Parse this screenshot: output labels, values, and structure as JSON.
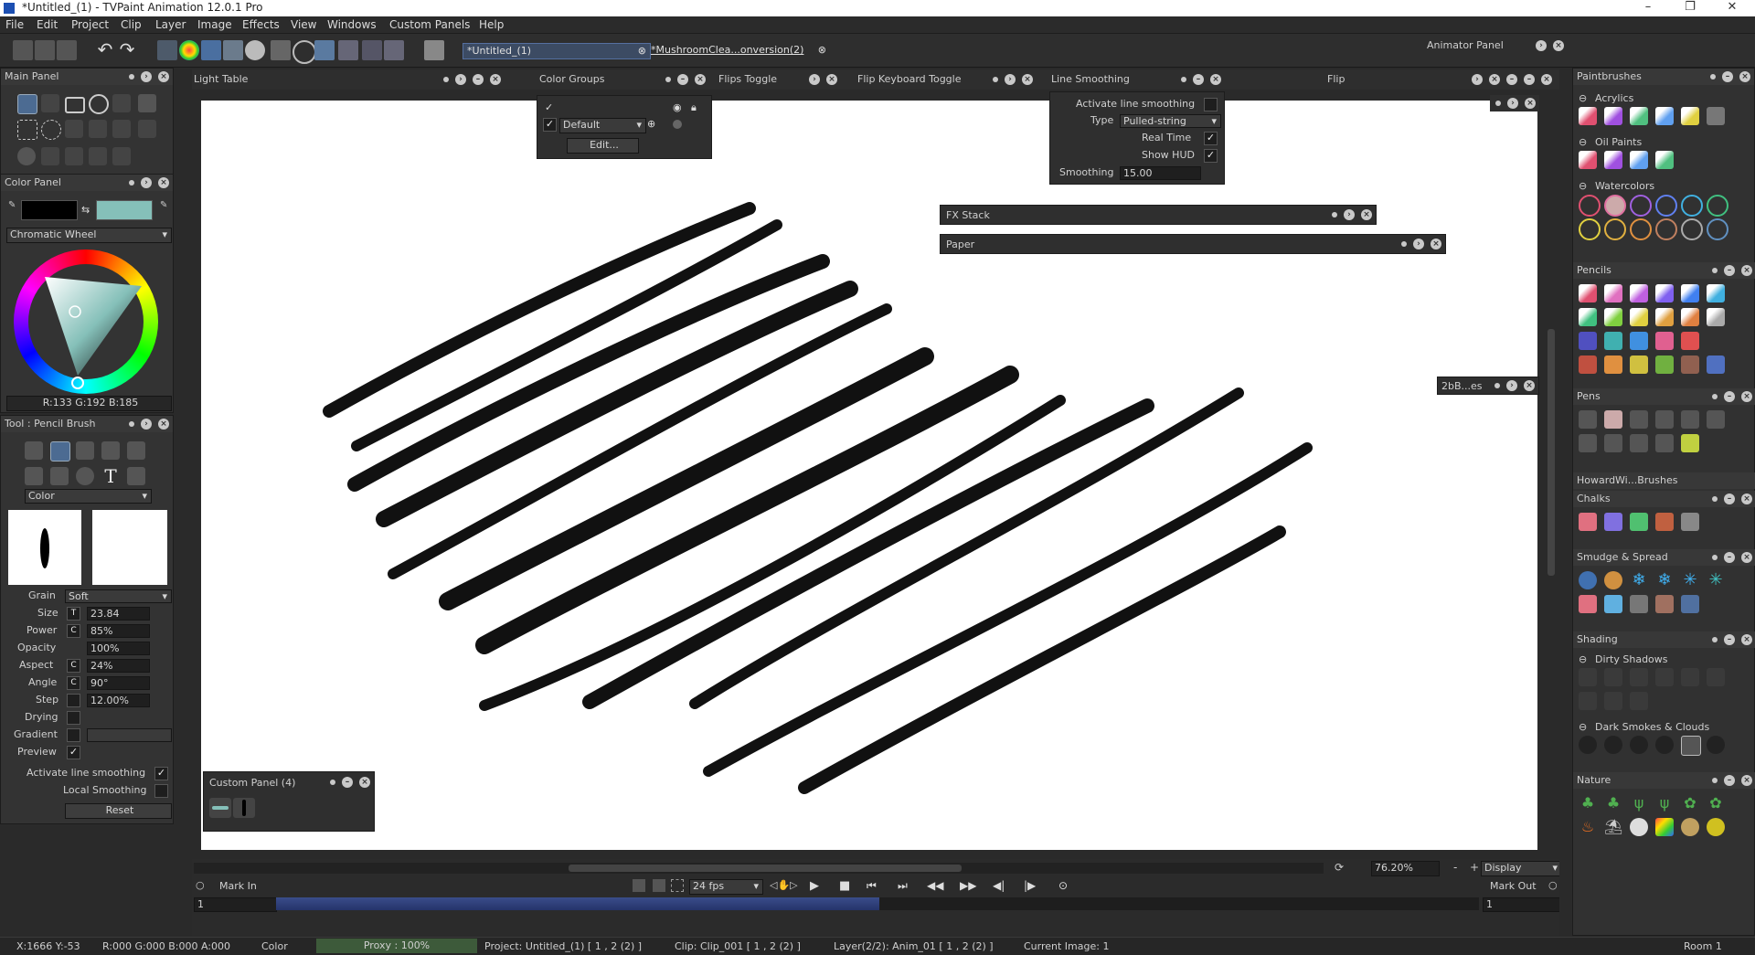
{
  "window": {
    "title": "*Untitled_(1) - TVPaint Animation 12.0.1 Pro"
  },
  "menu": [
    "File",
    "Edit",
    "Project",
    "Clip",
    "Layer",
    "Image",
    "Effects",
    "View",
    "Windows",
    "Custom Panels",
    "Help"
  ],
  "doc_tabs": {
    "active": "*Untitled_(1)",
    "other": "*MushroomClea...onversion(2)"
  },
  "animator_panel": "Animator Panel",
  "panels": {
    "main": "Main Panel",
    "color": "Color Panel",
    "color_mode": "Chromatic Wheel",
    "rgb_readout": "R:133 G:192 B:185",
    "fg_color": "#000000",
    "bg_color": "#85c0b9",
    "tool": "Tool : Pencil Brush",
    "tool_mode": "Color",
    "light_table": "Light Table",
    "color_groups": "Color Groups",
    "flips_toggle": "Flips Toggle",
    "flip_keyboard_toggle": "Flip Keyboard Toggle",
    "line_smoothing": "Line Smoothing",
    "flip": "Flip",
    "fx_stack": "FX Stack",
    "paper": "Paper",
    "custom_panel": "Custom Panel (4)",
    "bb_es": "2bB...es"
  },
  "color_groups": {
    "group": "Default",
    "edit_label": "Edit..."
  },
  "line_smoothing": {
    "activate_label": "Activate line smoothing",
    "type_label": "Type",
    "type_value": "Pulled-string",
    "realtime_label": "Real Time",
    "showhud_label": "Show HUD",
    "smoothing_label": "Smoothing",
    "smoothing_value": "15.00"
  },
  "tool_params": {
    "grain_label": "Grain",
    "grain_value": "Soft",
    "size_label": "Size",
    "size_value": "23.84",
    "power_label": "Power",
    "power_value": "85%",
    "opacity_label": "Opacity",
    "opacity_value": "100%",
    "aspect_label": "Aspect",
    "aspect_value": "24%",
    "angle_label": "Angle",
    "angle_value": "90°",
    "step_label": "Step",
    "step_value": "12.00%",
    "drying_label": "Drying",
    "gradient_label": "Gradient",
    "preview_label": "Preview",
    "activate_smoothing_label": "Activate line smoothing",
    "local_smoothing_label": "Local Smoothing",
    "reset_label": "Reset"
  },
  "brushes": {
    "header": "Paintbrushes",
    "acrylics": "Acrylics",
    "oil": "Oil Paints",
    "watercolors": "Watercolors",
    "pencils": "Pencils",
    "pens": "Pens",
    "howard": "HowardWi...Brushes",
    "chalks": "Chalks",
    "smudge": "Smudge & Spread",
    "shading": "Shading",
    "dirty_shadows": "Dirty Shadows",
    "dark_smokes": "Dark Smokes & Clouds",
    "nature": "Nature"
  },
  "timeline": {
    "zoom": "76.20%",
    "display": "Display",
    "mark_in": "Mark In",
    "mark_out": "Mark Out",
    "fps": "24 fps",
    "frame_in": "1",
    "frame_out": "1"
  },
  "status": {
    "coords": "X:1666  Y:-53",
    "rgba": "R:000 G:000 B:000 A:000",
    "color": "Color",
    "proxy": "Proxy : 100%",
    "project": "Project: Untitled_(1) [ 1 , 2  (2) ]",
    "clip": "Clip: Clip_001 [ 1 , 2  (2) ]",
    "layer": "Layer(2/2): Anim_01 [ 1 , 2  (2) ]",
    "image": "Current Image: 1",
    "room": "Room 1"
  }
}
